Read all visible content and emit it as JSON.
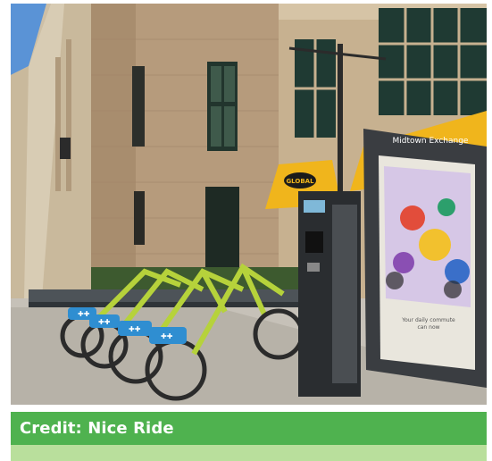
{
  "photo": {
    "alt": "Bike share station with lime-green bicycles docked in front of a tan brick building, a payment kiosk and an advertising display",
    "sign_text": "Midtown Exchange",
    "awning_text": "GLOBAL",
    "poster_lines": [
      "Your daily commute",
      "can now"
    ],
    "colors": {
      "bike": "#b6d23b",
      "basket": "#2f8ed1",
      "awning": "#f0b51c",
      "brick": "#b69b7c",
      "sky": "#5a93d6"
    }
  },
  "caption": {
    "text": "Credit: Nice Ride",
    "color": "#4fb24f",
    "secondary_color": "#b9df9c"
  }
}
